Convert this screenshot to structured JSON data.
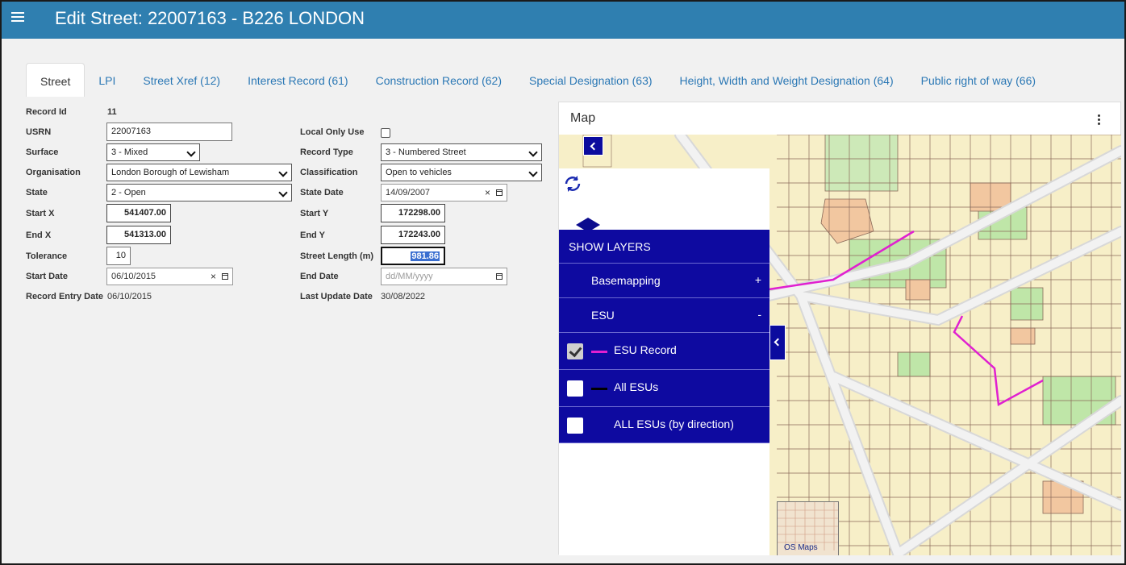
{
  "header": {
    "title": "Edit Street: 22007163 - B226 LONDON"
  },
  "tabs": [
    {
      "label": "Street",
      "active": true
    },
    {
      "label": "LPI"
    },
    {
      "label": "Street Xref (12)"
    },
    {
      "label": "Interest Record (61)"
    },
    {
      "label": "Construction Record (62)"
    },
    {
      "label": "Special Designation (63)"
    },
    {
      "label": "Height, Width and Weight Designation (64)"
    },
    {
      "label": "Public right of way (66)"
    }
  ],
  "form": {
    "record_id_label": "Record Id",
    "record_id": "11",
    "usrn_label": "USRN",
    "usrn": "22007163",
    "local_only_label": "Local Only Use",
    "surface_label": "Surface",
    "surface": "3 - Mixed",
    "record_type_label": "Record Type",
    "record_type": "3 - Numbered Street",
    "organisation_label": "Organisation",
    "organisation": "London Borough of Lewisham",
    "classification_label": "Classification",
    "classification": "Open to vehicles",
    "state_label": "State",
    "state": "2 - Open",
    "state_date_label": "State Date",
    "state_date": "14/09/2007",
    "start_x_label": "Start X",
    "start_x": "541407.00",
    "start_y_label": "Start Y",
    "start_y": "172298.00",
    "end_x_label": "End X",
    "end_x": "541313.00",
    "end_y_label": "End Y",
    "end_y": "172243.00",
    "tolerance_label": "Tolerance",
    "tolerance": "10",
    "street_length_label": "Street Length (m)",
    "street_length": "981.86",
    "start_date_label": "Start Date",
    "start_date": "06/10/2015",
    "end_date_label": "End Date",
    "end_date_placeholder": "dd/MM/yyyy",
    "record_entry_label": "Record Entry Date",
    "record_entry": "06/10/2015",
    "last_update_label": "Last Update Date",
    "last_update": "30/08/2022",
    "clear_glyph": "×"
  },
  "map": {
    "title": "Map",
    "show_layers": "SHOW LAYERS",
    "basemapping": "Basemapping",
    "basemapping_toggle": "+",
    "esu": "ESU",
    "esu_toggle": "-",
    "layers": [
      {
        "label": "ESU Record",
        "checked": true,
        "color": "#e020d0"
      },
      {
        "label": "All ESUs",
        "checked": false,
        "color": "#000000"
      },
      {
        "label": "ALL ESUs (by direction)",
        "checked": false
      }
    ],
    "os_maps_label": "OS Maps",
    "zoom_level": "17"
  },
  "colors": {
    "topbar": "#2f7fb0",
    "layer_panel": "#0e0aa0",
    "tab_link": "#2b78b5"
  }
}
